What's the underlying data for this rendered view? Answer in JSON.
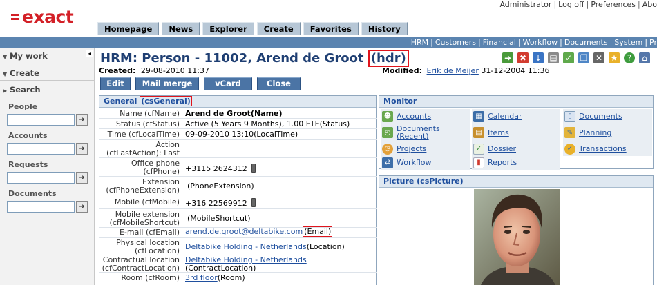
{
  "logo": {
    "text": "exact"
  },
  "top_links": [
    "Administrator",
    "Log off",
    "Preferences",
    "Abo"
  ],
  "main_tabs": [
    "Homepage",
    "News",
    "Explorer",
    "Create",
    "Favorites",
    "History"
  ],
  "subnav": [
    "HRM",
    "Customers",
    "Financial",
    "Workflow",
    "Documents",
    "System",
    "Pr"
  ],
  "sidebar": {
    "collapse_glyph": "◂",
    "my_work": "My work",
    "create": "Create",
    "search": "Search",
    "groups": [
      "People",
      "Accounts",
      "Requests",
      "Documents"
    ],
    "go_glyph": "➔"
  },
  "header": {
    "title": "HRM: Person - 11002, Arend de Groot",
    "title_suffix": "(hdr)",
    "created_label": "Created:",
    "created_value": "29-08-2010 11:37",
    "modified_label": "Modified:",
    "modified_by": "Erik de Meijer",
    "modified_value": "31-12-2004 11:36"
  },
  "buttons": [
    "Edit",
    "Mail merge",
    "vCard",
    "Close"
  ],
  "tool_icons": [
    "export-icon",
    "delete-icon",
    "import-icon",
    "print-icon",
    "approve-icon",
    "copy-icon",
    "tools-icon",
    "favorite-icon",
    "help-icon",
    "home-icon"
  ],
  "general": {
    "title": "General",
    "title_cs": "(csGeneral)",
    "rows": [
      {
        "label": "Name (cfName)",
        "value": "Arend de Groot(Name)",
        "bold": true
      },
      {
        "label": "Status (cfStatus)",
        "value": "Active (5 Years 9 Months), 1.00 FTE(Status)"
      },
      {
        "label": "Time (cfLocalTime)",
        "value": "09-09-2010 13:10(LocalTime)"
      },
      {
        "label_1": "Action",
        "label_2": "(cfLastAction): Last",
        "value": ""
      },
      {
        "label_1": "Office phone",
        "label_2": "(cfPhone)",
        "value": "+3115 2624312",
        "phone": true
      },
      {
        "label_1": "Extension",
        "label_2": "(cfPhoneExtension)",
        "value": "(PhoneExtension)"
      },
      {
        "label": "Mobile (cfMobile)",
        "value": "+316 22569912",
        "phone": true
      },
      {
        "label_1": "Mobile extension",
        "label_2": "(cfMobileShortcut)",
        "value": "(MobileShortcut)"
      },
      {
        "label": "E-mail (cfEmail)",
        "link": "arend.de.groot@deltabike.com",
        "suffix": "(Email)"
      },
      {
        "label_1": "Physical location",
        "label_2": "(cfLocation)",
        "link": "Deltabike Holding - Netherlands",
        "suffix": "(Location)"
      },
      {
        "label_1": "Contractual location",
        "label_2": "(cfContractLocation)",
        "link": "Deltabike Holding - Netherlands",
        "suffix": "(ContractLocation)"
      },
      {
        "label": "Room (cfRoom)",
        "link": "3rd floor",
        "suffix": "(Room)"
      }
    ]
  },
  "monitor": {
    "title": "Monitor",
    "items": [
      {
        "label": "Accounts",
        "icon": "people-icon"
      },
      {
        "label": "Calendar",
        "icon": "calendar-icon"
      },
      {
        "label": "Documents",
        "icon": "document-icon"
      },
      {
        "label_1": "Documents",
        "label_2": "(Recent)",
        "icon": "recent-documents-icon"
      },
      {
        "label": "Items",
        "icon": "items-icon"
      },
      {
        "label": "Planning",
        "icon": "planning-icon"
      },
      {
        "label": "Projects",
        "icon": "projects-icon"
      },
      {
        "label": "Dossier",
        "icon": "dossier-icon"
      },
      {
        "label": "Transactions",
        "icon": "transactions-icon"
      },
      {
        "label": "Workflow",
        "icon": "workflow-icon"
      },
      {
        "label": "Reports",
        "icon": "reports-icon"
      }
    ]
  },
  "picture": {
    "title": "Picture (csPicture)"
  },
  "colors": {
    "brand": "#d32027",
    "title": "#1f3f73",
    "subnav": "#5b84b0",
    "button": "#4b74a5",
    "highlight": "#e0141c",
    "link": "#1f4f9e"
  }
}
